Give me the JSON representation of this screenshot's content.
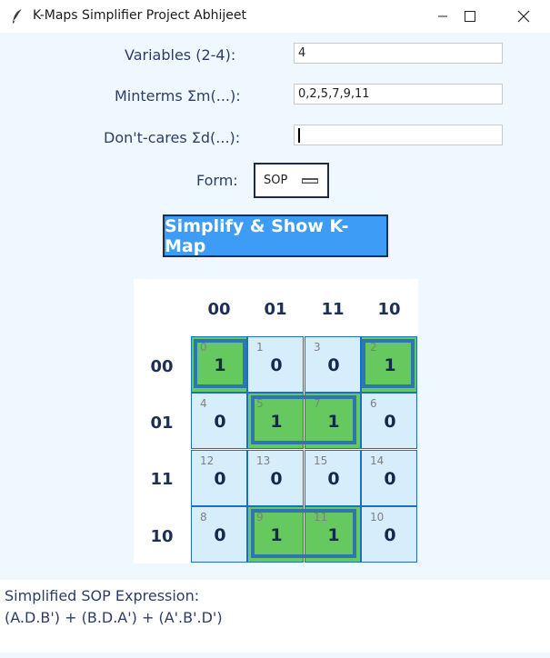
{
  "window": {
    "title": "K-Maps Simplifier Project Abhijeet"
  },
  "form": {
    "variables_label": "Variables (2-4):",
    "variables_value": "4",
    "minterms_label": "Minterms Σm(...):",
    "minterms_value": "0,2,5,7,9,11",
    "dontcares_label": "Don't-cares Σd(...):",
    "dontcares_value": "",
    "form_label": "Form:",
    "form_value": "SOP",
    "simplify_label": "Simplify & Show K-Map"
  },
  "kmap": {
    "col_headers": [
      "00",
      "01",
      "11",
      "10"
    ],
    "row_headers": [
      "00",
      "01",
      "11",
      "10"
    ],
    "cells": [
      [
        {
          "index": "0",
          "value": "1"
        },
        {
          "index": "1",
          "value": "0"
        },
        {
          "index": "3",
          "value": "0"
        },
        {
          "index": "2",
          "value": "1"
        }
      ],
      [
        {
          "index": "4",
          "value": "0"
        },
        {
          "index": "5",
          "value": "1"
        },
        {
          "index": "7",
          "value": "1"
        },
        {
          "index": "6",
          "value": "0"
        }
      ],
      [
        {
          "index": "12",
          "value": "0"
        },
        {
          "index": "13",
          "value": "0"
        },
        {
          "index": "15",
          "value": "0"
        },
        {
          "index": "14",
          "value": "0"
        }
      ],
      [
        {
          "index": "8",
          "value": "0"
        },
        {
          "index": "9",
          "value": "1"
        },
        {
          "index": "11",
          "value": "1"
        },
        {
          "index": "10",
          "value": "0"
        }
      ]
    ],
    "colors": {
      "cell_one": "#66c95f",
      "cell_zero": "#d6edfc",
      "group_border": "#2f76b1"
    }
  },
  "result": {
    "title": "Simplified SOP Expression:",
    "expression": "(A.D.B') + (B.D.A') + (A'.B'.D')"
  }
}
